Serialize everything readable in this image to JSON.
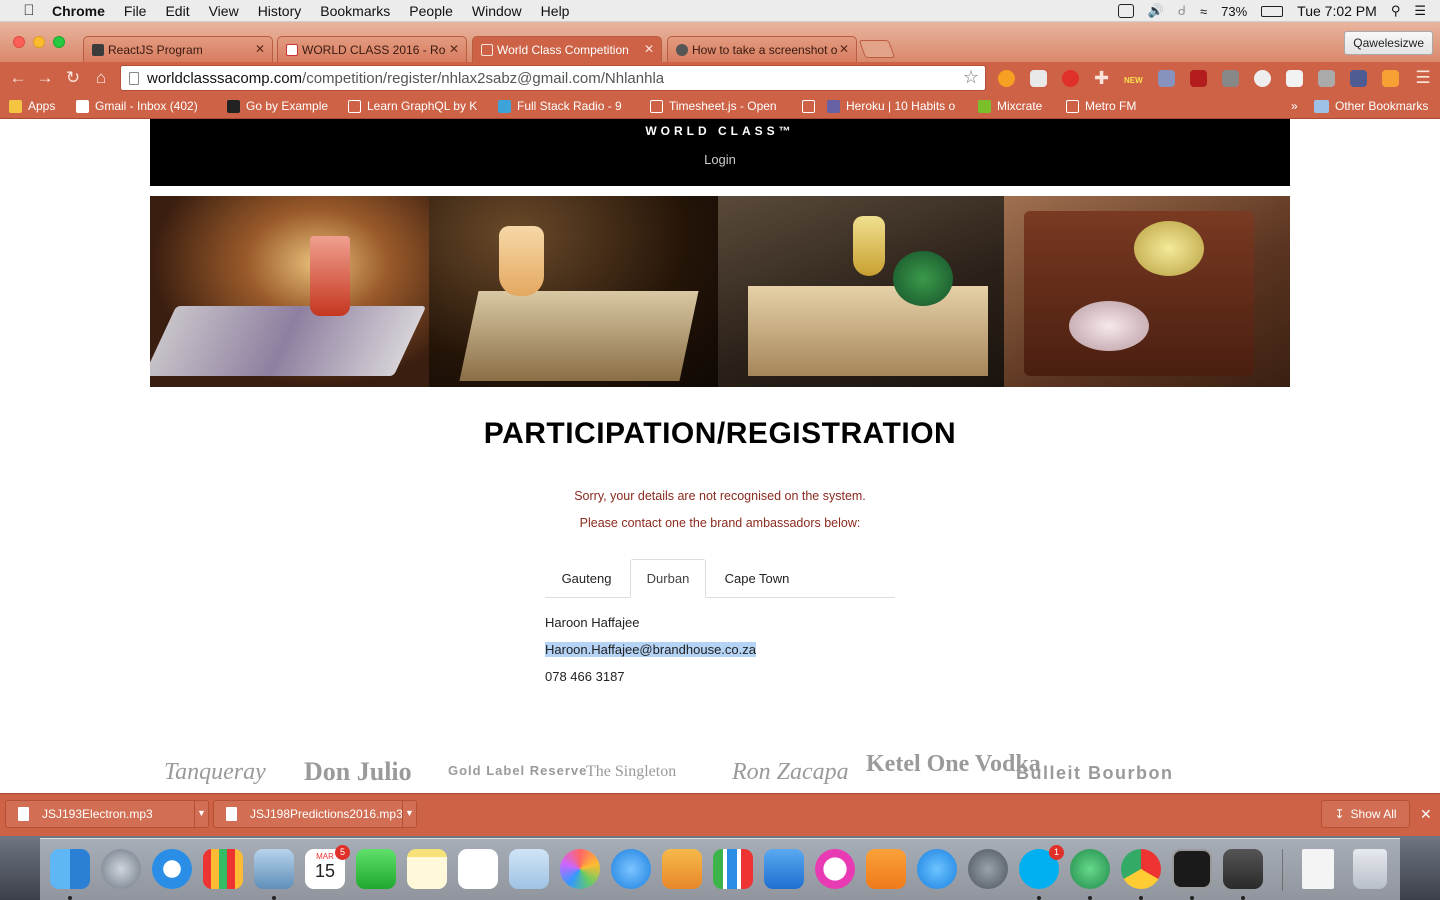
{
  "menubar": {
    "app": "Chrome",
    "items": [
      "File",
      "Edit",
      "View",
      "History",
      "Bookmarks",
      "People",
      "Window",
      "Help"
    ],
    "battery": "73%",
    "clock": "Tue 7:02 PM"
  },
  "browser": {
    "tabs": [
      {
        "title": "ReactJS Program"
      },
      {
        "title": "WORLD CLASS 2016 - Ro"
      },
      {
        "title": "World Class Competition"
      },
      {
        "title": "How to take a screenshot o"
      }
    ],
    "profile": "Qawelesizwe",
    "url_host": "worldclasssacomp.com",
    "url_path": "/competition/register/nhlax2sabz@gmail.com/Nhlanhla",
    "new_badge": "NEW",
    "bookmarks": [
      "Apps",
      "Gmail - Inbox (402)",
      "Go by Example",
      "Learn GraphQL by K",
      "Full Stack Radio - 9",
      "Timesheet.js - Open",
      "Heroku | 10 Habits o",
      "Mixcrate",
      "Metro FM"
    ],
    "other_bookmarks": "Other Bookmarks"
  },
  "site": {
    "brand": "WORLD CLASS™",
    "login": "Login",
    "heading": "PARTICIPATION/REGISTRATION",
    "notice_1": "Sorry, your details are not recognised on the system.",
    "notice_2": "Please contact one the brand ambassadors below:",
    "regions": [
      "Gauteng",
      "Durban",
      "Cape Town"
    ],
    "active_region": "Durban",
    "contact": {
      "name": "Haroon Haffajee",
      "email": "Haroon.Haffajee@brandhouse.co.za",
      "phone": "078 466 3187"
    },
    "brands": [
      "Tanqueray",
      "Don Julio",
      "Gold Label Reserve",
      "The Singleton",
      "Ron Zacapa",
      "Ketel One Vodka",
      "Bulleit Bourbon"
    ]
  },
  "downloads": {
    "files": [
      "JSJ193Electron.mp3",
      "JSJ198Predictions2016.mp3"
    ],
    "show_all": "Show All"
  },
  "dock": {
    "calendar_month": "MAR",
    "calendar_day": "15",
    "calendar_badge": "5",
    "skype_badge": "1"
  }
}
